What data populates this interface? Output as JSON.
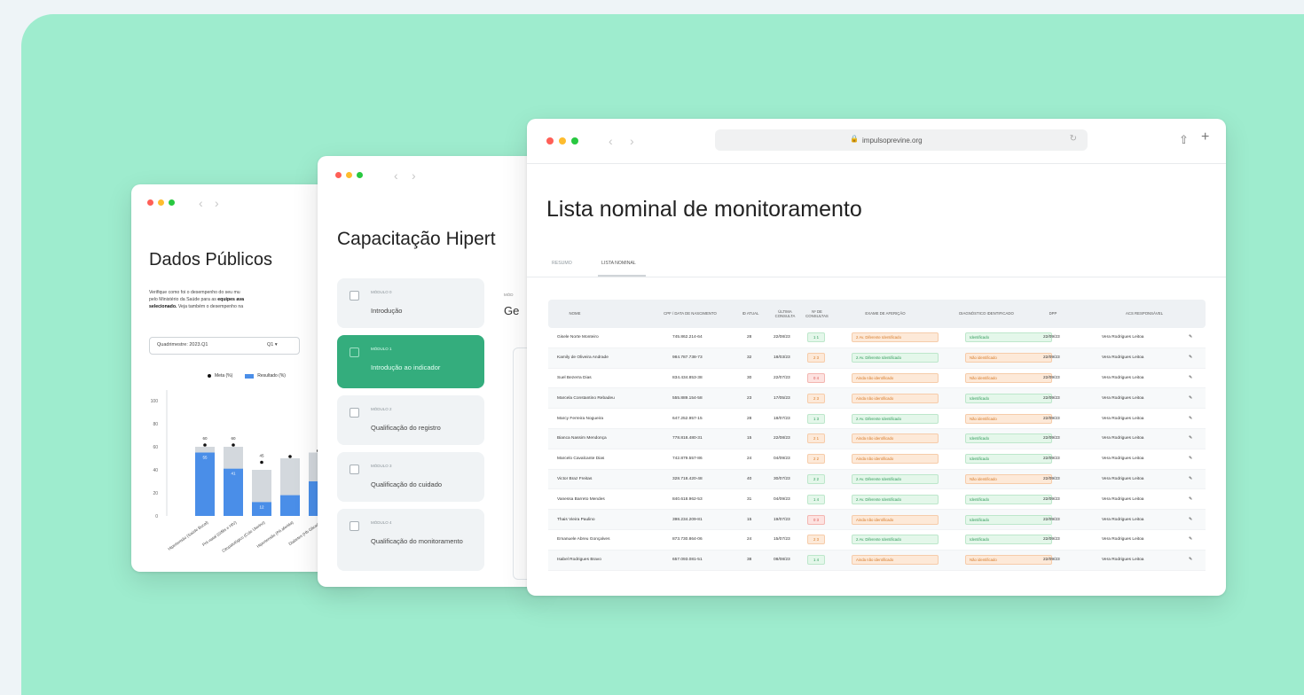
{
  "colors": {
    "background": "#9eecce",
    "accent_green": "#34ad7d",
    "bar_blue": "#4a8ee8",
    "bar_gray": "#d3d8dd",
    "dot_red": "#ff5f57",
    "dot_yellow": "#febc2e",
    "dot_green": "#28c840"
  },
  "window1": {
    "title": "Dados Públicos",
    "para_line1": "Verifique como foi o desempenho do seu mu",
    "para_line2": "pelo Ministério da Saúde para as ",
    "para_line2_bold": "equipes ava",
    "para_line3_bold": "selecionado.",
    "para_line3": " Veja também o desempenho na",
    "select_label": "Quadrimestre: 2023.Q1",
    "select_value": "Q1 ▾",
    "legend_meta": "Meta (%)",
    "legend_result": "Resultado (%)",
    "chart_data": {
      "type": "bar",
      "y_ticks": [
        "100",
        "80",
        "60",
        "40",
        "20",
        "0"
      ],
      "ylim": [
        0,
        100
      ],
      "categories": [
        "Hipertensão (Saúde Bucal)",
        "Pré-natal (Sífilis e HIV)",
        "Citopatológico (Colo Uterino)",
        "Hipertensão (PA aferida)",
        "Diabetes (Hb Glicada)"
      ],
      "series": [
        {
          "values": [
            55,
            41,
            12,
            18,
            30
          ]
        },
        {
          "values": [
            60,
            60,
            40,
            50,
            55
          ]
        }
      ],
      "meta": [
        60,
        60,
        45,
        50,
        55
      ],
      "labels_top": [
        "60",
        "60",
        "45",
        "",
        ""
      ],
      "labels_inner": [
        "55",
        "41",
        "12",
        "",
        ""
      ]
    }
  },
  "window2": {
    "title": "Capacitação Hipert",
    "modules": [
      {
        "small": "MÓDULO 0",
        "name": "Introdução",
        "active": false
      },
      {
        "small": "MÓDULO 1",
        "name": "Introdução ao indicador",
        "active": true
      },
      {
        "small": "MÓDULO 2",
        "name": "Qualificação do registro",
        "active": false
      },
      {
        "small": "MÓDULO 3",
        "name": "Qualificação do cuidado",
        "active": false
      },
      {
        "small": "MÓDULO 4",
        "name": "Qualificação do monitoramento",
        "active": false
      }
    ],
    "side_small": "MÓD",
    "side_title": "Ge"
  },
  "window3": {
    "url": "impulsoprevine.org",
    "title": "Lista nominal de monitoramento",
    "tabs": [
      "RESUMO",
      "LISTA NOMINAL"
    ],
    "columns": [
      "NOME",
      "CPF / DATA DE NASCIMENTO",
      "ID ATUAL",
      "ÚLTIMA CONSULTA",
      "Nº DE CONSULTAS",
      "EXAME DE AFERIÇÃO",
      "DIAGNÓSTICO IDENTIFICADO",
      "DPP",
      "ACS RESPONSÁVEL"
    ],
    "rows": [
      {
        "nome": "Gisele Norte Monteiro",
        "cpf": "745.862.214-64",
        "id": "28",
        "ultima": "22/08/23",
        "cons": "1 1",
        "cons_t": "g",
        "exame": "2 Av. Diferente Identificado",
        "exame_t": "o",
        "diag": "Identificado",
        "diag_t": "g",
        "dpp": "22/09/23",
        "acs": "Vera Rodrigues Leitoa"
      },
      {
        "nome": "Kamily de Oliveira Andrade",
        "cpf": "984.787.738-73",
        "id": "32",
        "ultima": "18/03/23",
        "cons": "2 3",
        "cons_t": "o",
        "exame": "2 Av. Diferente Identificado",
        "exame_t": "g",
        "diag": "Não identificado",
        "diag_t": "o",
        "dpp": "22/09/23",
        "acs": "Vera Rodrigues Leitoa"
      },
      {
        "nome": "Suel Bezerra Dias",
        "cpf": "834.434.853-38",
        "id": "30",
        "ultima": "22/07/23",
        "cons": "0 4",
        "cons_t": "r",
        "exame": "Ainda não identificado",
        "exame_t": "o",
        "diag": "Não identificado",
        "diag_t": "o",
        "dpp": "22/09/23",
        "acs": "Vera Rodrigues Leitoa"
      },
      {
        "nome": "Marcela Constantino Rebadeu",
        "cpf": "555.889.154-58",
        "id": "23",
        "ultima": "17/05/23",
        "cons": "2 3",
        "cons_t": "o",
        "exame": "Ainda não identificado",
        "exame_t": "o",
        "diag": "Identificado",
        "diag_t": "g",
        "dpp": "22/09/23",
        "acs": "Vera Rodrigues Leitoa"
      },
      {
        "nome": "Marcy Ferreira Nogueira",
        "cpf": "647.252.957-15",
        "id": "28",
        "ultima": "18/07/23",
        "cons": "1 3",
        "cons_t": "g",
        "exame": "2 Av. Diferente Identificado",
        "exame_t": "g",
        "diag": "Não identificado",
        "diag_t": "o",
        "dpp": "22/09/23",
        "acs": "Vera Rodrigues Leitoa"
      },
      {
        "nome": "Bianca Nassim Mendonça",
        "cpf": "778.818.480-31",
        "id": "15",
        "ultima": "22/08/23",
        "cons": "2 1",
        "cons_t": "o",
        "exame": "Ainda não identificado",
        "exame_t": "o",
        "diag": "Identificado",
        "diag_t": "g",
        "dpp": "22/09/23",
        "acs": "Vera Rodrigues Leitoa"
      },
      {
        "nome": "Marcelo Cavalcante Dias",
        "cpf": "742.879.557-86",
        "id": "24",
        "ultima": "04/09/23",
        "cons": "2 2",
        "cons_t": "o",
        "exame": "Ainda não identificado",
        "exame_t": "o",
        "diag": "Identificado",
        "diag_t": "g",
        "dpp": "22/09/23",
        "acs": "Vera Rodrigues Leitoa"
      },
      {
        "nome": "Victor Braz Freitas",
        "cpf": "328.718.420-48",
        "id": "40",
        "ultima": "30/07/23",
        "cons": "2 2",
        "cons_t": "g",
        "exame": "2 Av. Diferente Identificado",
        "exame_t": "g",
        "diag": "Não identificado",
        "diag_t": "o",
        "dpp": "22/09/23",
        "acs": "Vera Rodrigues Leitoa"
      },
      {
        "nome": "Vanessa Barreto Mendes",
        "cpf": "840.618.962-53",
        "id": "31",
        "ultima": "04/09/23",
        "cons": "1 4",
        "cons_t": "g",
        "exame": "2 Av. Diferente Identificado",
        "exame_t": "g",
        "diag": "Identificado",
        "diag_t": "g",
        "dpp": "22/09/23",
        "acs": "Vera Rodrigues Leitoa"
      },
      {
        "nome": "Thais Vieira Paulino",
        "cpf": "398.234.209-81",
        "id": "15",
        "ultima": "19/07/23",
        "cons": "0 3",
        "cons_t": "r",
        "exame": "Ainda não identificado",
        "exame_t": "o",
        "diag": "Identificado",
        "diag_t": "g",
        "dpp": "22/09/23",
        "acs": "Vera Rodrigues Leitoa"
      },
      {
        "nome": "Emanuele Abreu Gonçalves",
        "cpf": "873.730.864-06",
        "id": "24",
        "ultima": "15/07/23",
        "cons": "2 3",
        "cons_t": "o",
        "exame": "2 Av. Diferente Identificado",
        "exame_t": "g",
        "diag": "Identificado",
        "diag_t": "g",
        "dpp": "22/09/23",
        "acs": "Vera Rodrigues Leitoa"
      },
      {
        "nome": "Isabel Rodrigues Bravo",
        "cpf": "657.093.081-51",
        "id": "38",
        "ultima": "08/08/23",
        "cons": "1 4",
        "cons_t": "g",
        "exame": "Ainda não identificado",
        "exame_t": "o",
        "diag": "Não identificado",
        "diag_t": "o",
        "dpp": "22/09/23",
        "acs": "Vera Rodrigues Leitoa"
      }
    ]
  }
}
